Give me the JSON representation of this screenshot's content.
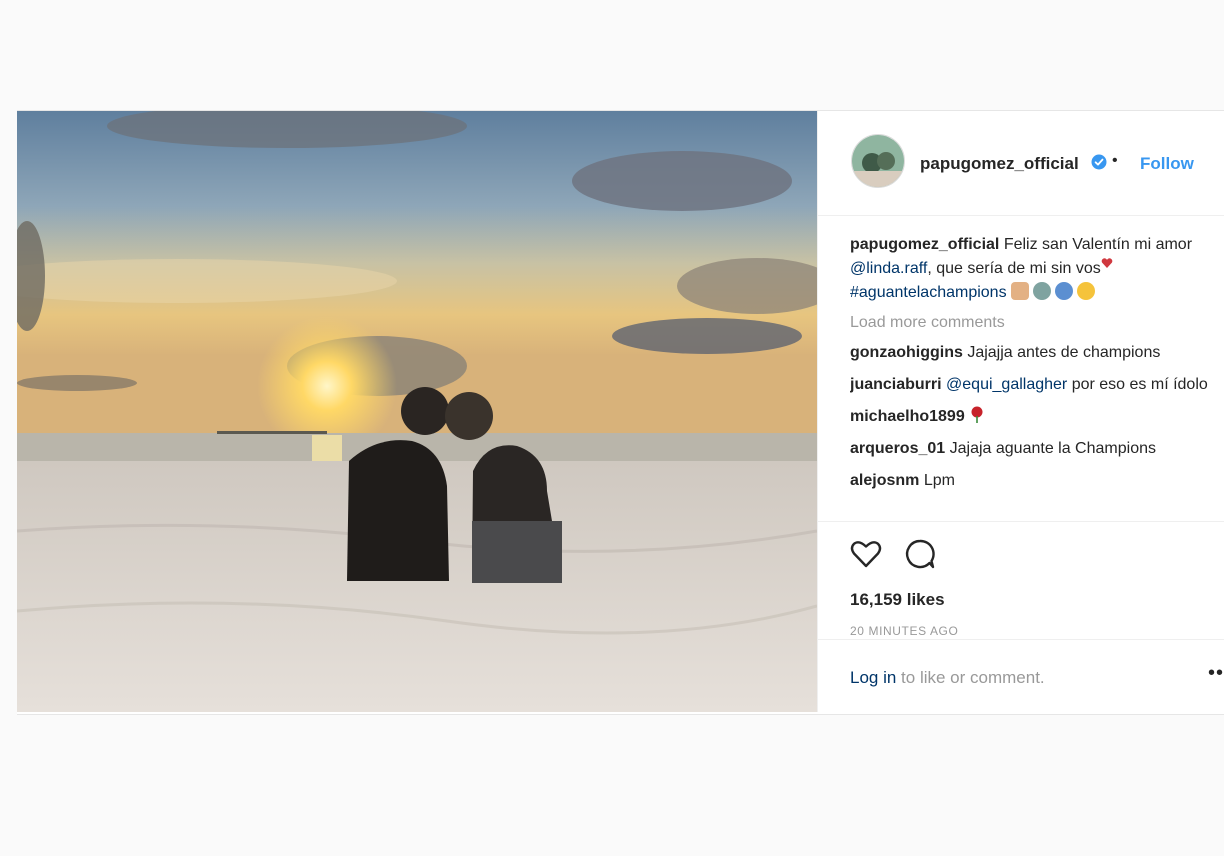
{
  "post": {
    "username": "papugomez_official",
    "follow_label": "Follow",
    "separator": "•",
    "caption": {
      "username": "papugomez_official",
      "text_1": "Feliz san Valentín mi amor",
      "mention": "@linda.raff",
      "text_2": ", que sería de mi sin vos",
      "hashtag": "#aguantelachampions"
    },
    "load_more_label": "Load more comments",
    "comments": [
      {
        "user": "gonzaohiggins",
        "text": "Jajajja antes de champions",
        "mention": ""
      },
      {
        "user": "juanciaburri",
        "text": "por eso es mí ídolo",
        "mention": "@equi_gallagher"
      },
      {
        "user": "michaelho1899",
        "text": "",
        "mention": ""
      },
      {
        "user": "arqueros_01",
        "text": "Jajaja aguante la Champions",
        "mention": ""
      },
      {
        "user": "alejosnm",
        "text": "Lpm",
        "mention": ""
      }
    ],
    "likes_label": "16,159 likes",
    "time_label": "20 MINUTES AGO",
    "login_link": "Log in",
    "login_rest": " to like or comment.",
    "more_label": "•••"
  },
  "icons": {
    "verified": "verified-badge-icon",
    "heart": "heart-icon",
    "comment": "comment-bubble-icon",
    "rose": "rose-icon"
  },
  "colors": {
    "link_blue": "#3897f0",
    "mention_blue": "#003569",
    "muted_gray": "#999999",
    "text_dark": "#262626"
  }
}
